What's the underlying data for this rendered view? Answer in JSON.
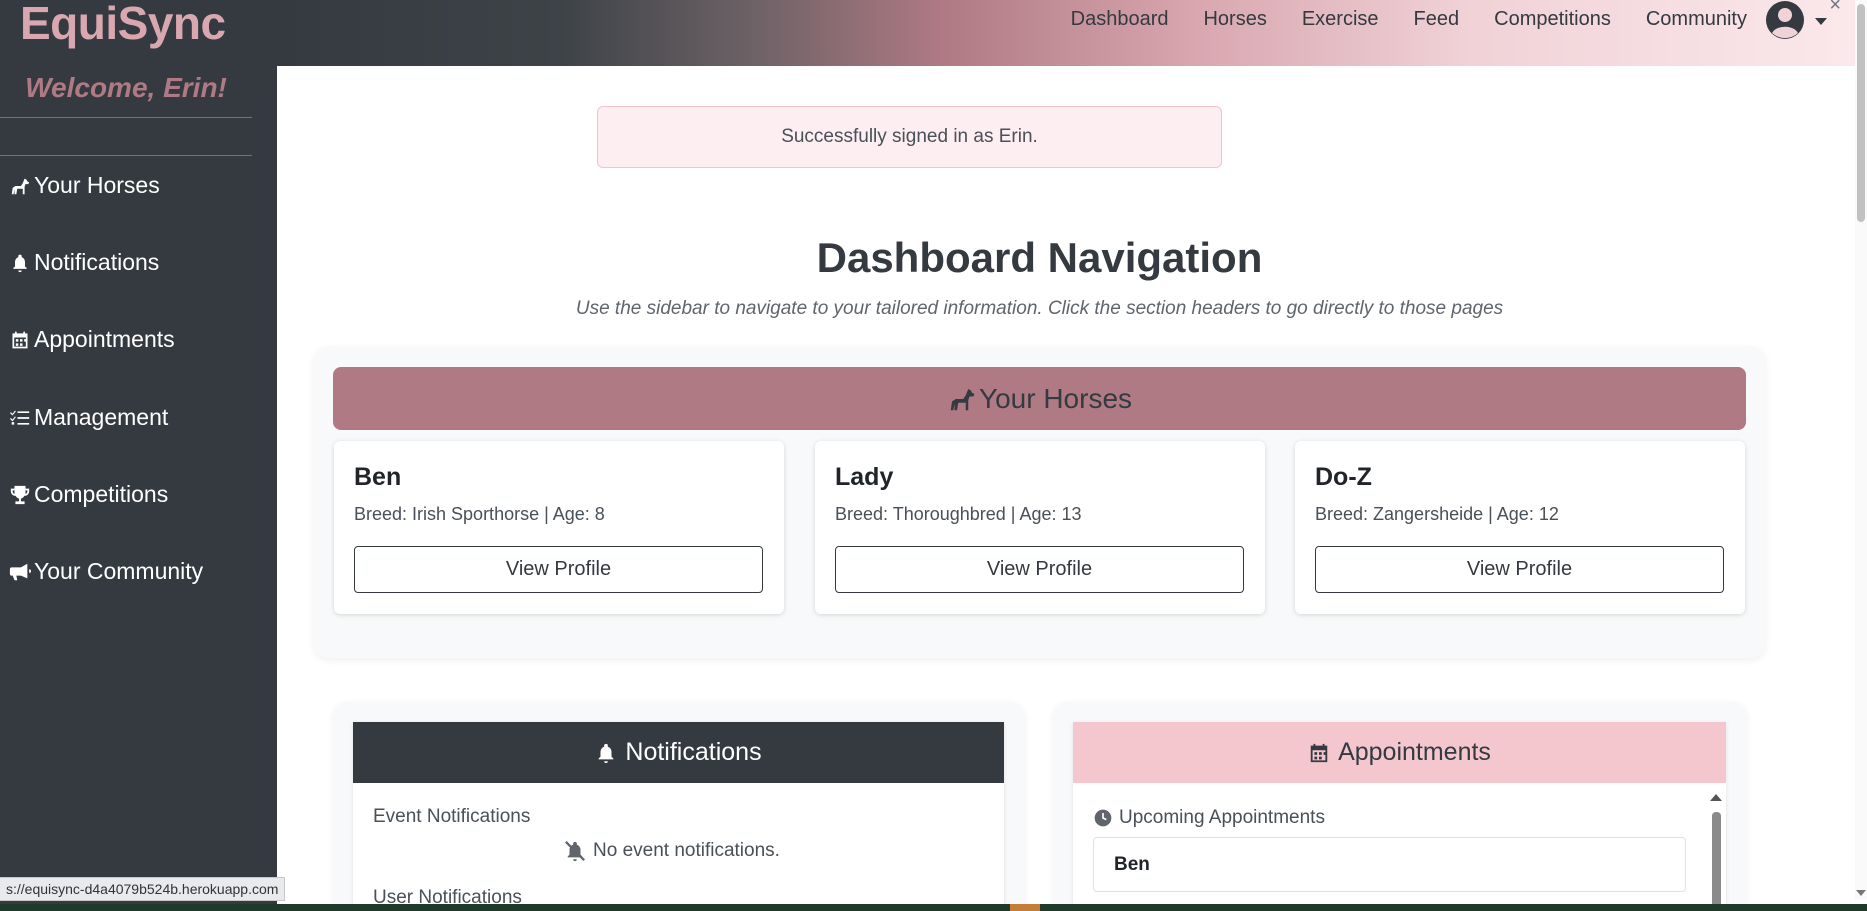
{
  "sidebar": {
    "brand": "EquiSync",
    "welcome": "Welcome, Erin!",
    "items": [
      {
        "label": "Your Horses",
        "icon": "horse-icon"
      },
      {
        "label": "Notifications",
        "icon": "bell-icon"
      },
      {
        "label": "Appointments",
        "icon": "calendar-icon"
      },
      {
        "label": "Management",
        "icon": "list-check-icon"
      },
      {
        "label": "Competitions",
        "icon": "trophy-icon"
      },
      {
        "label": "Your Community",
        "icon": "bullhorn-icon"
      }
    ]
  },
  "topnav": {
    "links": [
      "Dashboard",
      "Horses",
      "Exercise",
      "Feed",
      "Competitions",
      "Community"
    ],
    "close": "×"
  },
  "alert": {
    "text": "Successfully signed in as Erin."
  },
  "main": {
    "title": "Dashboard Navigation",
    "subtitle": "Use the sidebar to navigate to your tailored information. Click the section headers to go directly to those pages"
  },
  "horses": {
    "header": "Your Horses",
    "cards": [
      {
        "name": "Ben",
        "info": "Breed: Irish Sporthorse | Age: 8",
        "button": "View Profile"
      },
      {
        "name": "Lady",
        "info": "Breed: Thoroughbred | Age: 13",
        "button": "View Profile"
      },
      {
        "name": "Do-Z",
        "info": "Breed: Zangersheide | Age: 12",
        "button": "View Profile"
      }
    ]
  },
  "notifications": {
    "header": "Notifications",
    "event_title": "Event Notifications",
    "empty": "No event notifications.",
    "user_title": "User Notifications"
  },
  "appointments": {
    "header": "Appointments",
    "upcoming_title": "Upcoming Appointments",
    "first_item": "Ben"
  },
  "status_bar": {
    "url": "s://equisync-d4a4079b524b.herokuapp.com"
  },
  "colors": {
    "sidebar_bg": "#343a40",
    "brand": "#d9a7b0",
    "accent_mauve": "#b07a84",
    "accent_pink": "#f4c7cf",
    "alert_bg": "#fdeef1"
  }
}
